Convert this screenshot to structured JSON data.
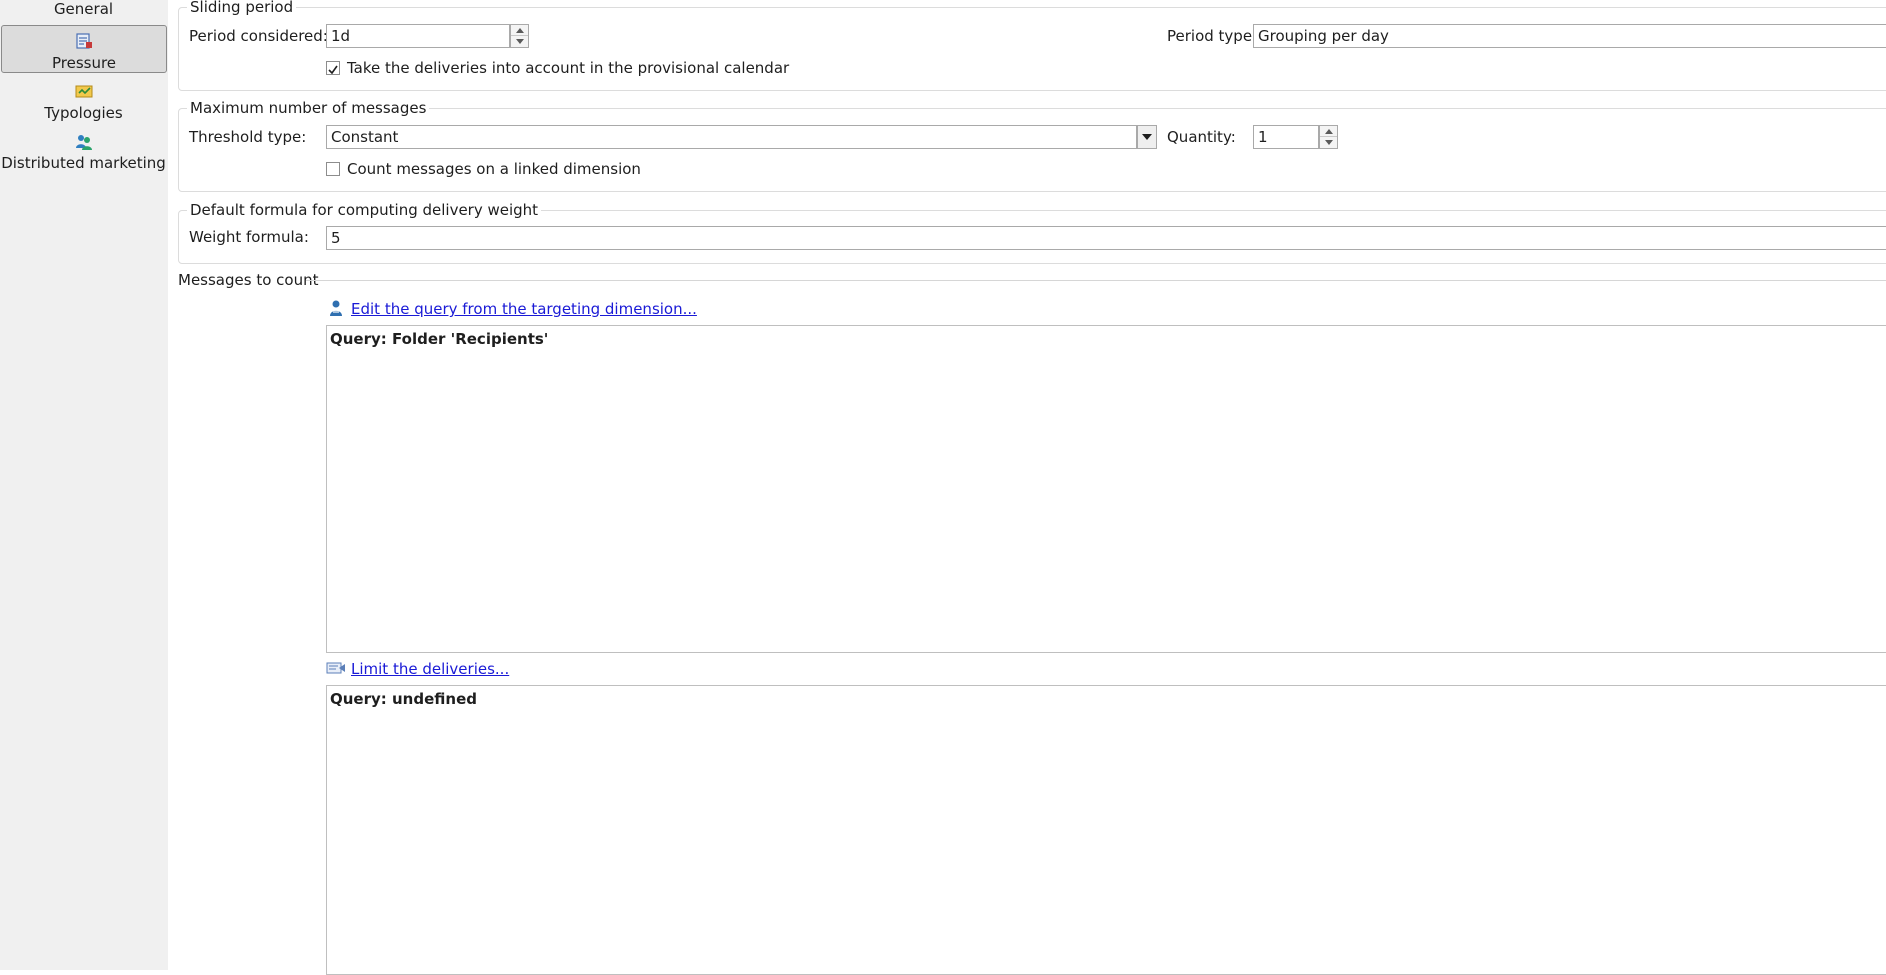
{
  "nav": {
    "items": [
      {
        "label": "General",
        "icon": "general-icon"
      },
      {
        "label": "Pressure",
        "icon": "pressure-icon"
      },
      {
        "label": "Typologies",
        "icon": "typologies-icon"
      },
      {
        "label": "Distributed marketing",
        "icon": "distributed-marketing-icon"
      }
    ],
    "active": "Pressure"
  },
  "sliding_period": {
    "title": "Sliding period",
    "period_considered_label": "Period considered:",
    "period_considered_value": "1d",
    "period_type_label": "Period type:",
    "period_type_value": "Grouping per day",
    "provisional_checkbox_label": "Take the deliveries into account in the provisional calendar",
    "provisional_checked": true
  },
  "max_messages": {
    "title": "Maximum number of messages",
    "threshold_type_label": "Threshold type:",
    "threshold_type_value": "Constant",
    "quantity_label": "Quantity:",
    "quantity_value": "1",
    "linked_dimension_label": "Count messages on a linked dimension",
    "linked_dimension_checked": false
  },
  "weight": {
    "title": "Default formula for computing delivery weight",
    "formula_label": "Weight formula:",
    "formula_value": "5"
  },
  "messages_to_count": {
    "title": "Messages to count",
    "edit_query_link": "Edit the query from the targeting dimension...",
    "query_text": "Query: Folder 'Recipients'",
    "limit_link": "Limit the deliveries...",
    "limit_query_text": "Query: undefined"
  },
  "colors": {
    "link": "#1a1ad6",
    "panel_bg": "#f0f0f0",
    "active_nav": "#dcdcdc"
  }
}
